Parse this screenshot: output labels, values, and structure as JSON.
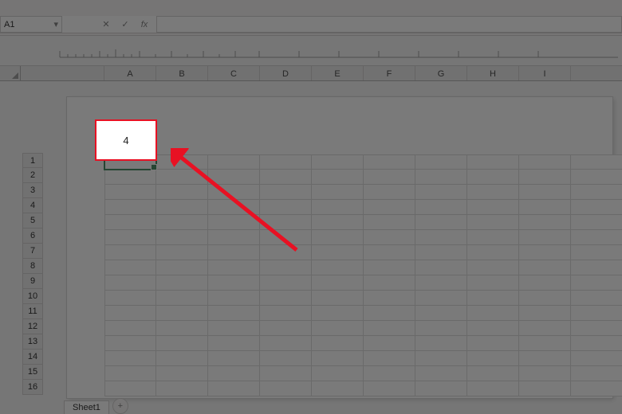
{
  "formula_bar": {
    "name_box_value": "A1",
    "cancel_glyph": "✕",
    "confirm_glyph": "✓",
    "fx_label": "fx",
    "formula_value": ""
  },
  "columns": [
    "A",
    "B",
    "C",
    "D",
    "E",
    "F",
    "G",
    "H",
    "I"
  ],
  "rows": [
    "1",
    "2",
    "3",
    "4",
    "5",
    "6",
    "7",
    "8",
    "9",
    "10",
    "11",
    "12",
    "13",
    "14",
    "15",
    "16"
  ],
  "active_cell": "A1",
  "callout_value": "4",
  "sheet_tabs": {
    "active": "Sheet1",
    "new_glyph": "+"
  },
  "colors": {
    "accent": "#217346",
    "annotation": "#e81123"
  }
}
